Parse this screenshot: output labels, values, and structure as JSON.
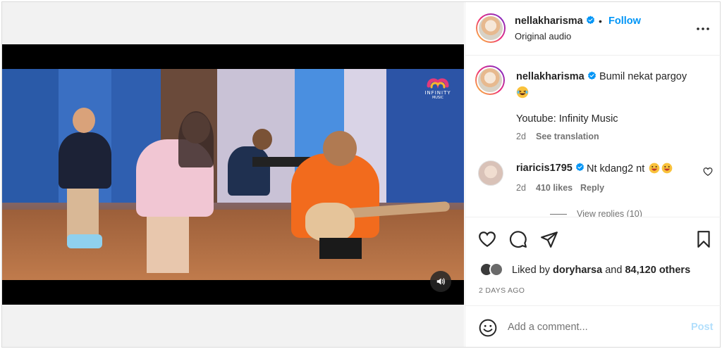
{
  "post": {
    "username": "nellakharisma",
    "follow_label": "Follow",
    "dot": "•",
    "audio_label": "Original audio",
    "more_icon": "more-horizontal-icon",
    "verified_color": "#0095f6"
  },
  "video": {
    "logo_text": "INFINITY",
    "logo_sub": "MUSIC",
    "mute_icon": "speaker-icon"
  },
  "caption": {
    "username": "nellakharisma",
    "text": "Bumil nekat pargoy",
    "emoji": "laughing-emoji",
    "line2": "Youtube: Infinity Music",
    "age": "2d",
    "translate_label": "See translation"
  },
  "comment": {
    "username": "riaricis1795",
    "text": "Nt kdang2 nt",
    "emojis": [
      "grinning-emoji",
      "grinning-emoji"
    ],
    "age": "2d",
    "likes": "410 likes",
    "reply_label": "Reply",
    "view_replies": "View replies (10)"
  },
  "actions": {
    "liked_prefix": "Liked by",
    "liked_user": "doryharsa",
    "liked_and": "and",
    "liked_others": "84,120 others",
    "date": "2 DAYS AGO"
  },
  "comment_input": {
    "placeholder": "Add a comment...",
    "post_label": "Post",
    "post_color": "#b2dffc"
  }
}
